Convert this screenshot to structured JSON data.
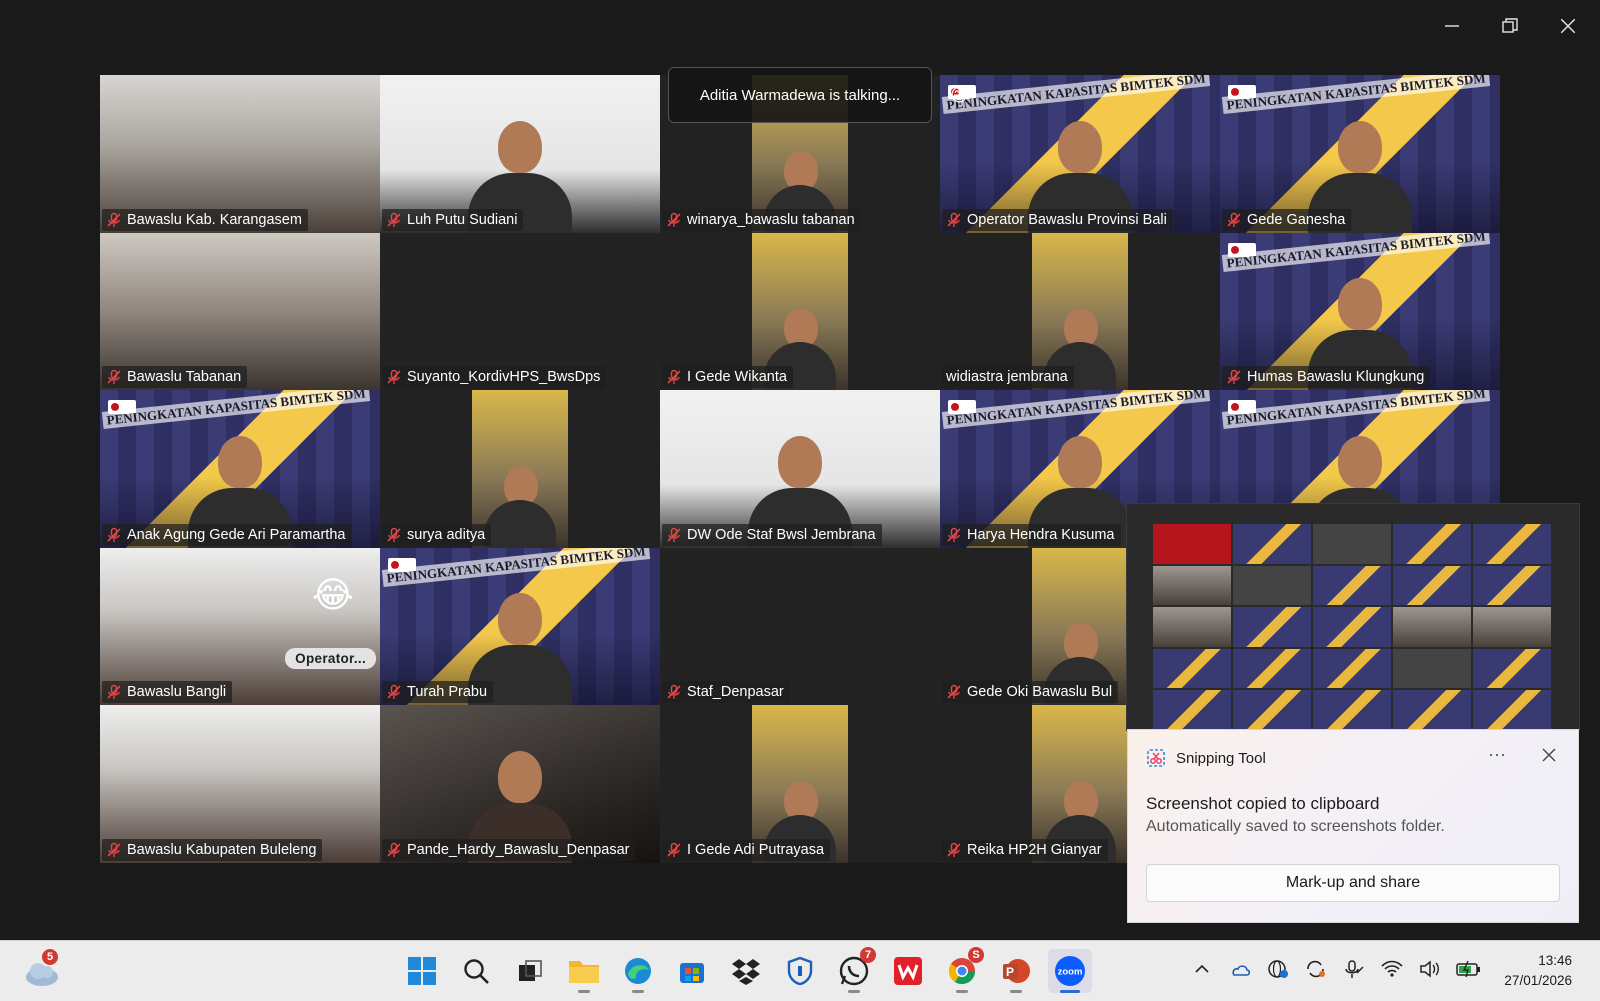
{
  "window": {
    "minimize_icon": "minimize-icon",
    "restore_icon": "restore-icon",
    "close_icon": "close-icon"
  },
  "talking_indicator": "Aditia Warmadewa is talking...",
  "participants": [
    {
      "name": "Bawaslu Kab. Karangasem",
      "bg": "room"
    },
    {
      "name": "Luh Putu Sudiani",
      "bg": "white"
    },
    {
      "name": "winarya_bawaslu tabanan",
      "bg": "dark"
    },
    {
      "name": "Operator Bawaslu Provinsi Bali",
      "bg": "gold"
    },
    {
      "name": "Gede Ganesha",
      "bg": "gold"
    },
    {
      "name": "Bawaslu Tabanan",
      "bg": "room2"
    },
    {
      "name": "Suyanto_KordivHPS_BwsDps",
      "bg": "off"
    },
    {
      "name": "I Gede Wikanta",
      "bg": "dark"
    },
    {
      "name": "widiastra jembrana",
      "bg": "dark"
    },
    {
      "name": "Humas Bawaslu Klungkung",
      "bg": "gold"
    },
    {
      "name": "Anak Agung Gede Ari Paramartha",
      "bg": "gold"
    },
    {
      "name": "surya aditya",
      "bg": "dark"
    },
    {
      "name": "DW Ode Staf Bwsl Jembrana",
      "bg": "white"
    },
    {
      "name": "Harya Hendra Kusuma",
      "bg": "gold"
    },
    {
      "name": "",
      "bg": "gold"
    },
    {
      "name": "Bawaslu Bangli",
      "bg": "office"
    },
    {
      "name": "Turah Prabu",
      "bg": "gold"
    },
    {
      "name": "Staf_Denpasar",
      "bg": "off"
    },
    {
      "name": "Gede Oki Bawaslu Bul",
      "bg": "dark"
    },
    {
      "name": "",
      "bg": "off"
    },
    {
      "name": "Bawaslu Kabupaten Buleleng",
      "bg": "office"
    },
    {
      "name": "Pande_Hardy_Bawaslu_Denpasar",
      "bg": "car"
    },
    {
      "name": "I Gede Adi Putrayasa",
      "bg": "dark"
    },
    {
      "name": "Reika HP2H Gianyar",
      "bg": "dark"
    },
    {
      "name": "",
      "bg": "off"
    }
  ],
  "banner_text": "PENINGKATAN KAPASITAS BIMTEK SDM",
  "bangli_pill": "Operator...",
  "reaction_emoji": "😂",
  "small_reaction_emoji": "😁",
  "toast": {
    "app_name": "Snipping Tool",
    "more": "···",
    "title": "Screenshot copied to clipboard",
    "subtitle": "Automatically saved to screenshots folder.",
    "action": "Mark-up and share"
  },
  "taskbar": {
    "weather_badge": "5",
    "apps": [
      {
        "name": "start",
        "icon": "windows-logo-icon"
      },
      {
        "name": "search",
        "icon": "search-icon"
      },
      {
        "name": "task-view",
        "icon": "task-view-icon"
      },
      {
        "name": "file-explorer",
        "icon": "folder-icon"
      },
      {
        "name": "edge",
        "icon": "edge-icon"
      },
      {
        "name": "store",
        "icon": "store-icon"
      },
      {
        "name": "dropbox",
        "icon": "dropbox-icon"
      },
      {
        "name": "security",
        "icon": "shield-icon"
      },
      {
        "name": "whatsapp",
        "icon": "whatsapp-icon",
        "badge": "7"
      },
      {
        "name": "wps",
        "icon": "wps-icon"
      },
      {
        "name": "chrome",
        "icon": "chrome-icon",
        "badge": "S"
      },
      {
        "name": "powerpoint",
        "icon": "powerpoint-icon"
      },
      {
        "name": "zoom",
        "icon": "zoom-icon",
        "label": "zoom"
      }
    ],
    "time": "13:46",
    "date": "27/01/2026"
  },
  "colors": {
    "accent": "#2b6cd1",
    "mute_red": "#e04646",
    "zoom_blue": "#0b5cff",
    "gold": "#f4c84a"
  }
}
